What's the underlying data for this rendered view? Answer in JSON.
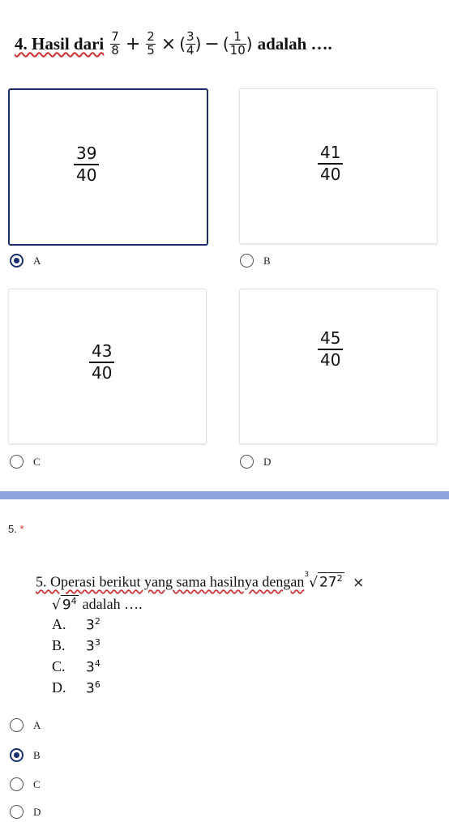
{
  "q4": {
    "prefix": "4. Hasil dari",
    "f1": {
      "num": "7",
      "den": "8"
    },
    "op1": "+",
    "f2": {
      "num": "2",
      "den": "5"
    },
    "op2": "×",
    "f3": {
      "num": "3",
      "den": "4"
    },
    "op3": "−",
    "f4": {
      "num": "1",
      "den": "10"
    },
    "suffix": "adalah ….",
    "options": [
      {
        "label": "A",
        "num": "39",
        "den": "40",
        "selected": true
      },
      {
        "label": "B",
        "num": "41",
        "den": "40",
        "selected": false
      },
      {
        "label": "C",
        "num": "43",
        "den": "40",
        "selected": false
      },
      {
        "label": "D",
        "num": "45",
        "den": "40",
        "selected": false
      }
    ]
  },
  "q5": {
    "number": "5.",
    "required_mark": "*",
    "stem_a": "5. Operasi berikut yang sama hasilnya dengan",
    "cube_root_index": "3",
    "cube_root_base": "27",
    "cube_root_exp": "2",
    "times": "×",
    "sqrt_base": "9",
    "sqrt_exp": "4",
    "stem_b": "adalah ….",
    "choices": [
      {
        "letter": "A.",
        "base": "3",
        "exp": "2"
      },
      {
        "letter": "B.",
        "base": "3",
        "exp": "3"
      },
      {
        "letter": "C.",
        "base": "3",
        "exp": "4"
      },
      {
        "letter": "D.",
        "base": "3",
        "exp": "6"
      }
    ],
    "options": [
      {
        "label": "A",
        "selected": false
      },
      {
        "label": "B",
        "selected": true
      },
      {
        "label": "C",
        "selected": false
      },
      {
        "label": "D",
        "selected": false
      }
    ]
  },
  "colors": {
    "accent": "#1a2f6b",
    "divider": "#8fa4dd",
    "required": "#d93025"
  }
}
